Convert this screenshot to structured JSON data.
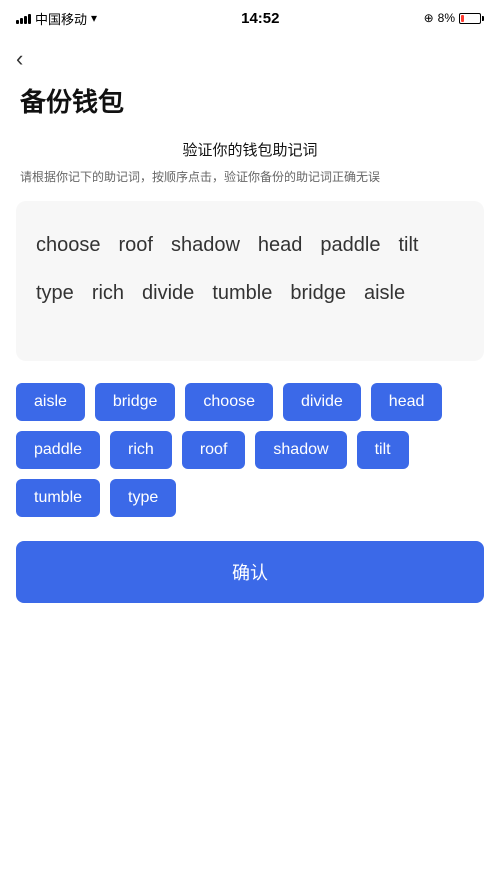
{
  "statusBar": {
    "carrier": "中国移动",
    "time": "14:52",
    "batteryPercent": "8%"
  },
  "backLabel": "‹",
  "pageTitle": "备份钱包",
  "sectionTitle": "验证你的钱包助记词",
  "sectionDesc": "请根据你记下的助记词，按顺序点击，验证你备份的助记词正确无误",
  "displayWords": [
    "choose",
    "roof",
    "shadow",
    "head",
    "paddle",
    "tilt",
    "type",
    "rich",
    "divide",
    "tumble",
    "bridge",
    "aisle"
  ],
  "chips": [
    "aisle",
    "bridge",
    "choose",
    "divide",
    "head",
    "paddle",
    "rich",
    "roof",
    "shadow",
    "tilt",
    "tumble",
    "type"
  ],
  "confirmLabel": "确认"
}
